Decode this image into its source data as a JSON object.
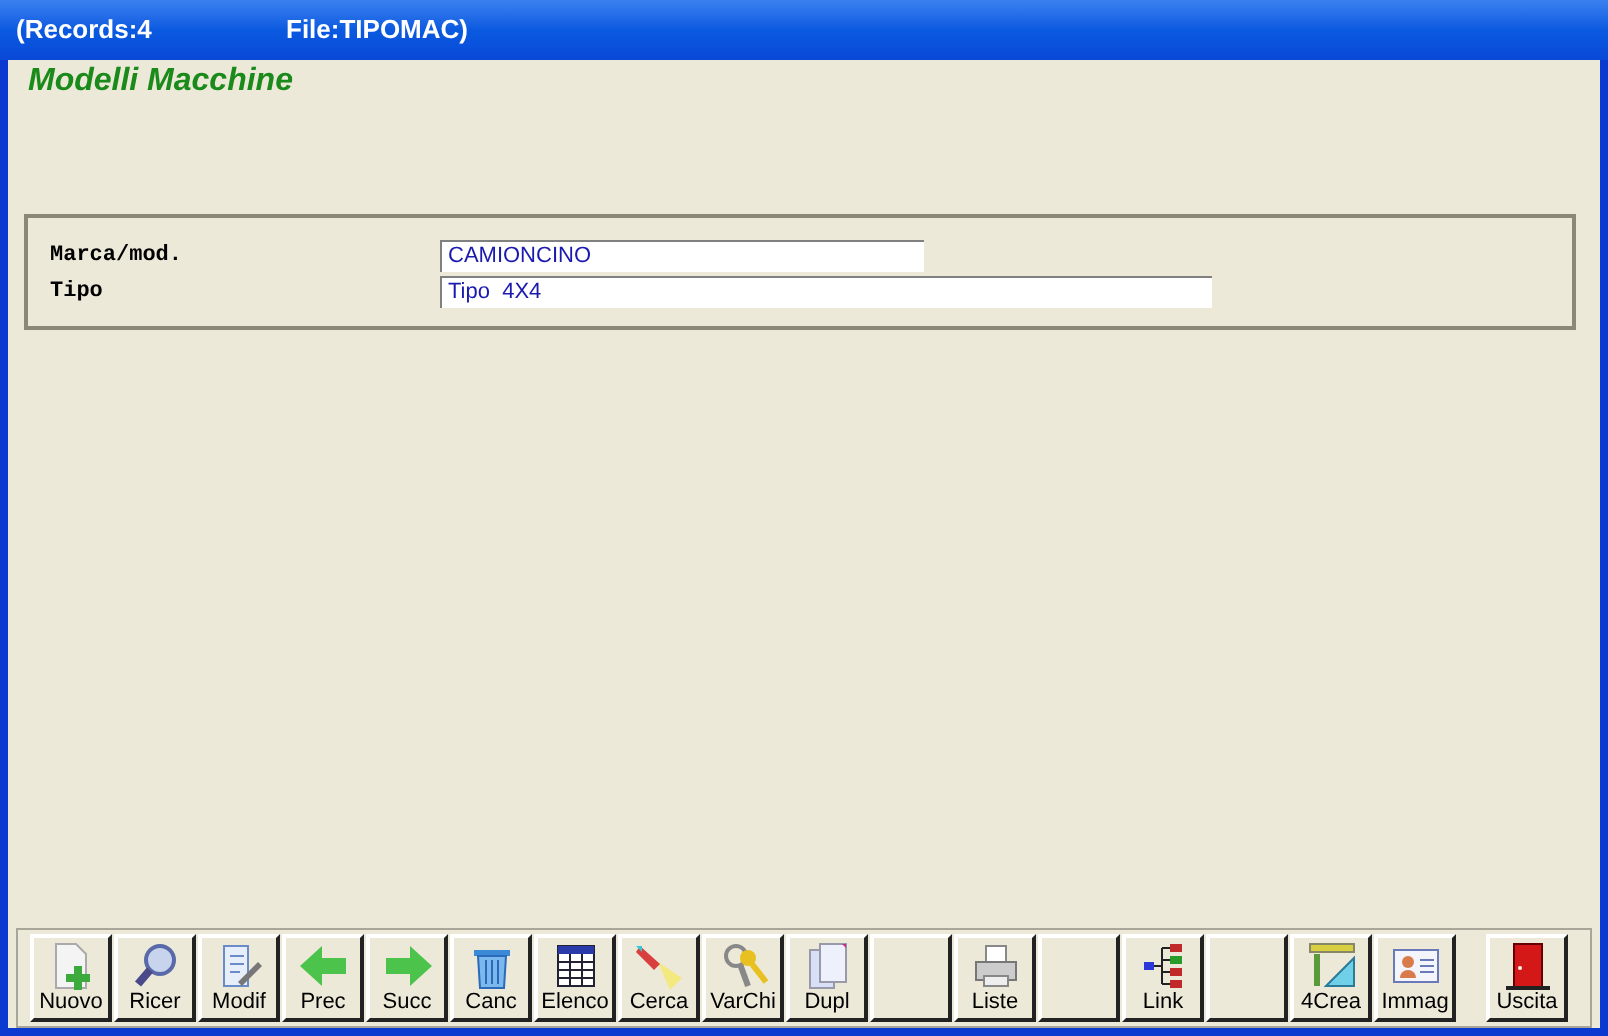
{
  "window": {
    "records": "(Records:4",
    "file": "File:TIPOMAC)"
  },
  "heading": "Modelli Macchine",
  "fields": [
    {
      "label": "Marca/mod.",
      "value": "CAMIONCINO",
      "kind": "short"
    },
    {
      "label": "Tipo",
      "value": "Tipo  4X4",
      "kind": "long"
    }
  ],
  "toolbar": [
    {
      "kind": "new",
      "label": "Nuovo"
    },
    {
      "kind": "search",
      "label": "Ricer"
    },
    {
      "kind": "edit",
      "label": "Modif"
    },
    {
      "kind": "prev",
      "label": "Prec"
    },
    {
      "kind": "next",
      "label": "Succ"
    },
    {
      "kind": "delete",
      "label": "Canc"
    },
    {
      "kind": "table",
      "label": "Elenco"
    },
    {
      "kind": "find",
      "label": "Cerca"
    },
    {
      "kind": "keys",
      "label": "VarChi"
    },
    {
      "kind": "duplicate",
      "label": "Dupl"
    },
    {
      "kind": "blank"
    },
    {
      "kind": "print",
      "label": "Liste"
    },
    {
      "kind": "blank"
    },
    {
      "kind": "link",
      "label": "Link"
    },
    {
      "kind": "blank"
    },
    {
      "kind": "create",
      "label": "4Crea"
    },
    {
      "kind": "image",
      "label": "Immag"
    },
    {
      "kind": "exit",
      "label": "Uscita"
    }
  ]
}
